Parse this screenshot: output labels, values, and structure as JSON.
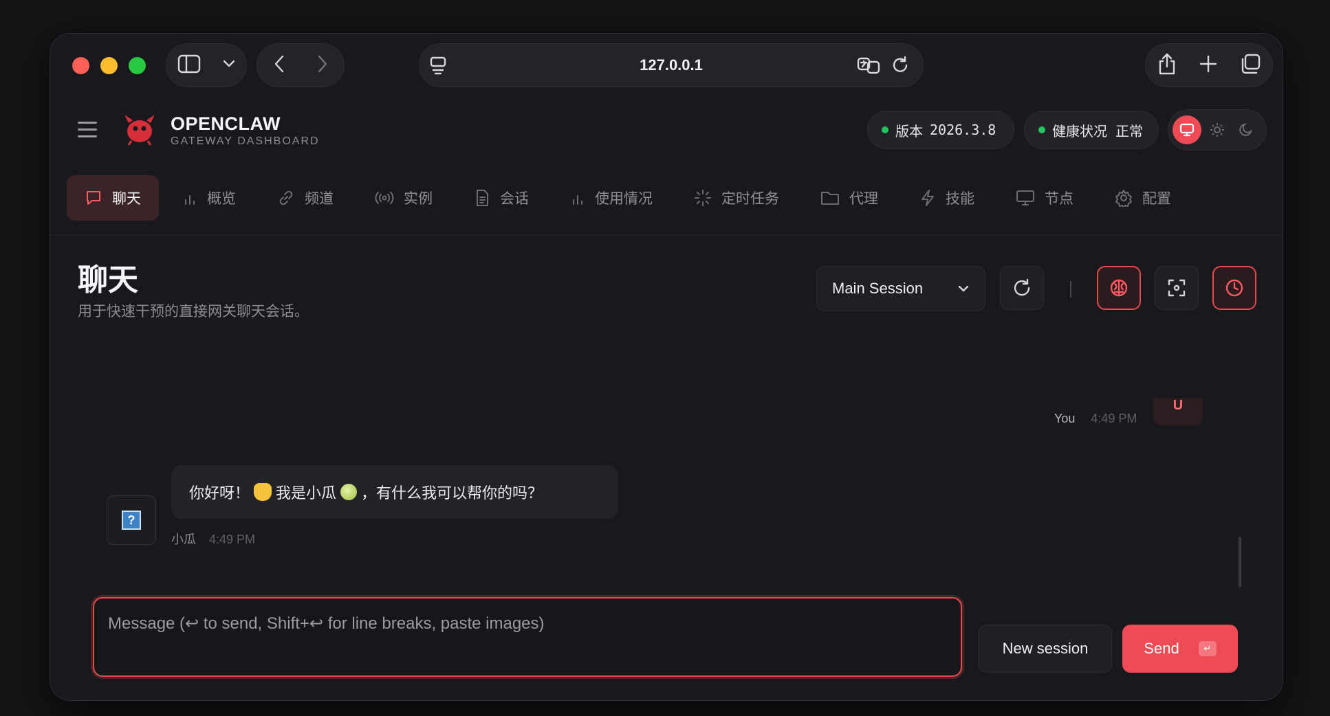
{
  "browser": {
    "url": "127.0.0.1"
  },
  "header": {
    "brand_title": "OPENCLAW",
    "brand_subtitle": "GATEWAY DASHBOARD",
    "version_label": "版本",
    "version_value": "2026.3.8",
    "health_label": "健康状况",
    "health_value": "正常",
    "status_color": "#22c55e",
    "accent_color": "#ef4b55"
  },
  "tabs": [
    {
      "label": "聊天",
      "icon": "message-icon",
      "active": true
    },
    {
      "label": "概览",
      "icon": "bar-chart-icon"
    },
    {
      "label": "频道",
      "icon": "link-icon"
    },
    {
      "label": "实例",
      "icon": "broadcast-icon"
    },
    {
      "label": "会话",
      "icon": "document-icon"
    },
    {
      "label": "使用情况",
      "icon": "bar-chart-icon"
    },
    {
      "label": "定时任务",
      "icon": "loader-icon"
    },
    {
      "label": "代理",
      "icon": "folder-icon"
    },
    {
      "label": "技能",
      "icon": "lightning-icon"
    },
    {
      "label": "节点",
      "icon": "monitor-icon"
    },
    {
      "label": "配置",
      "icon": "gear-icon"
    }
  ],
  "page": {
    "title": "聊天",
    "subtitle": "用于快速干预的直接网关聊天会话。",
    "session_select": "Main Session"
  },
  "messages": {
    "user": {
      "glyph": "U",
      "sender": "You",
      "time": "4:49 PM"
    },
    "bot": {
      "text_part1": "你好呀！",
      "text_part2": "我是小瓜",
      "text_part3": "，有什么我可以帮你的吗？",
      "sender": "小瓜",
      "time": "4:49 PM",
      "avatar_glyph": "?"
    }
  },
  "composer": {
    "placeholder": "Message (↩ to send, Shift+↩ for line breaks, paste images)",
    "value": "",
    "new_session_label": "New session",
    "send_label": "Send",
    "send_key": "↵"
  }
}
